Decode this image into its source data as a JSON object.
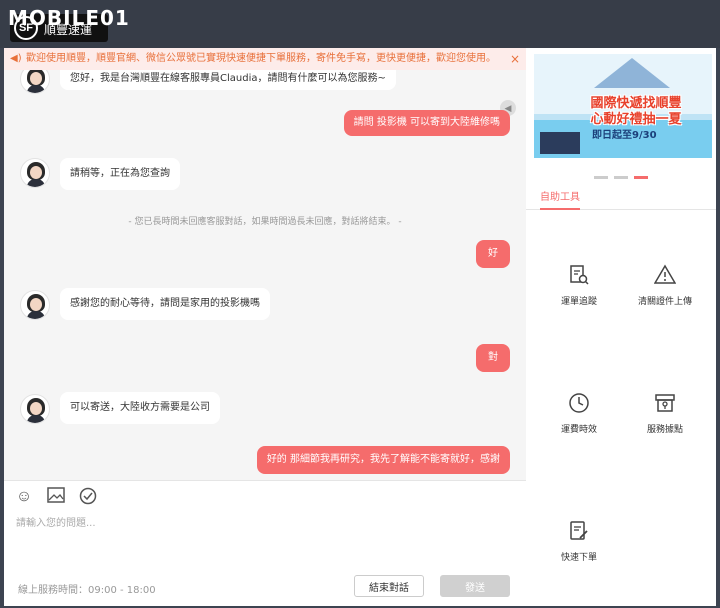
{
  "watermark": "MOBILE01",
  "brand": {
    "mark": "SF",
    "name": "順豐速運"
  },
  "notice": {
    "text": "歡迎使用順豐，順豐官網、微信公眾號已實現快速便捷下單服務，寄件免手寫，更快更便捷，歡迎您使用。",
    "close": "×",
    "speaker_icon": "speaker-icon"
  },
  "messages": [
    {
      "side": "in",
      "text": "您好，我是台灣順豐在線客服專員Claudia，請問有什麼可以為您服務~"
    },
    {
      "side": "out",
      "text": "請問 投影機 可以寄到大陸維修嗎"
    },
    {
      "side": "in",
      "text": "請稍等，正在為您查詢"
    },
    {
      "side": "sys",
      "text": "- 您已長時間未回應客服對話，如果時間過長未回應，對話將結束。 -"
    },
    {
      "side": "out",
      "text": "好"
    },
    {
      "side": "in",
      "text": "感謝您的耐心等待，請問是家用的投影機嗎"
    },
    {
      "side": "out",
      "text": "對"
    },
    {
      "side": "in",
      "text": "可以寄送，大陸收方需要是公司"
    },
    {
      "side": "out",
      "text": "好的 那細節我再研究，我先了解能不能寄就好，感謝"
    }
  ],
  "composer": {
    "placeholder": "請輸入您的問題...",
    "tools": [
      "emoji-icon",
      "image-icon",
      "check-icon"
    ],
    "hours": "線上服務時間：09:00 - 18:00",
    "end_label": "結束對話",
    "send_label": "發送"
  },
  "banner": {
    "line1": "國際快遞找順豐",
    "line2": "心動好禮抽一夏",
    "line3": "即日起至9/30"
  },
  "self_service": {
    "tab": "自助工具",
    "items": [
      {
        "label": "運單追蹤",
        "icon": "waybill-search-icon"
      },
      {
        "label": "清關證件上傳",
        "icon": "warning-icon"
      },
      {
        "label": "運費時效",
        "icon": "clock-icon"
      },
      {
        "label": "服務據點",
        "icon": "store-icon"
      },
      {
        "label": "快速下單",
        "icon": "edit-order-icon"
      }
    ]
  },
  "colors": {
    "accent": "#f56c6c",
    "notice_text": "#e8703a",
    "titlebar": "#373d48"
  }
}
